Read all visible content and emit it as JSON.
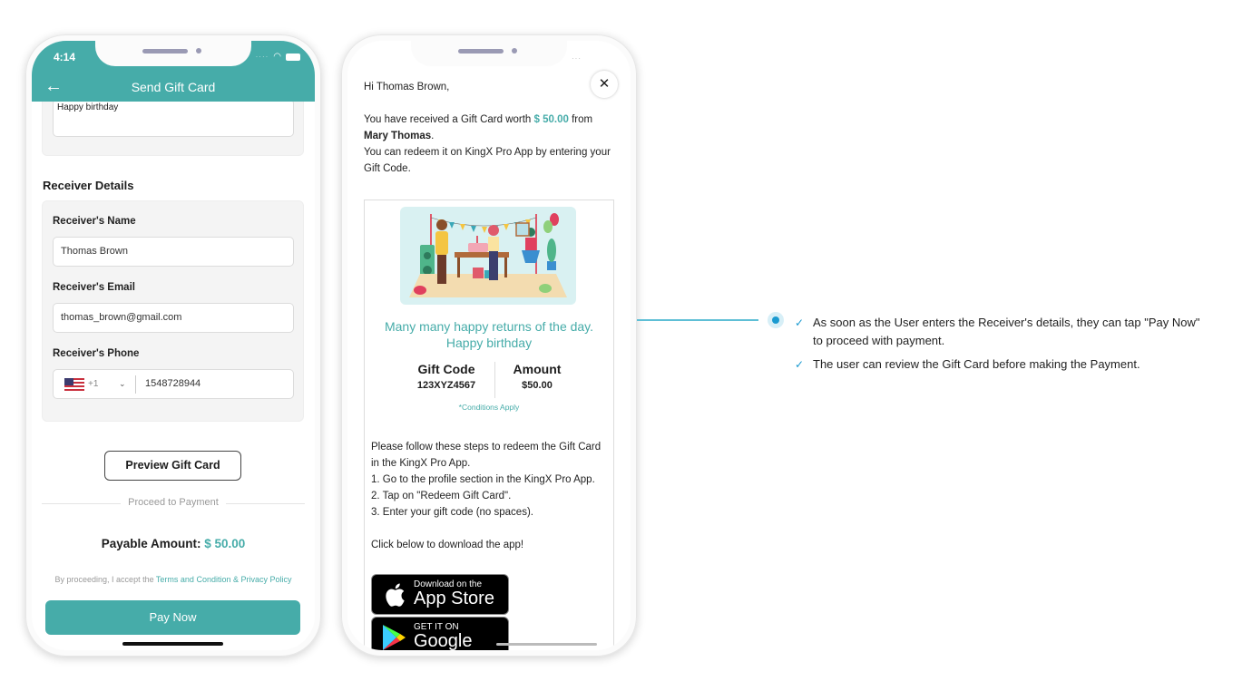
{
  "phone1": {
    "status_time": "4:14",
    "header_title": "Send Gift Card",
    "message_value": "Happy birthday",
    "section_title": "Receiver Details",
    "fields": {
      "name_label": "Receiver's Name",
      "name_value": "Thomas Brown",
      "email_label": "Receiver's Email",
      "email_value": "thomas_brown@gmail.com",
      "phone_label": "Receiver's Phone",
      "country_code": "+1",
      "phone_value": "1548728944"
    },
    "preview_button": "Preview Gift Card",
    "divider_text": "Proceed to Payment",
    "payable_label": "Payable Amount:",
    "payable_amount": "$ 50.00",
    "terms_prefix": "By proceeding, I accept the ",
    "terms_link": "Terms and Condition & Privacy Policy",
    "pay_button": "Pay Now"
  },
  "phone2": {
    "greeting": "Hi Thomas Brown,",
    "intro_prefix": "You have received a Gift Card worth ",
    "intro_amount": "$ 50.00",
    "intro_from": " from",
    "sender": "Mary Thomas",
    "redeem_note": "You can redeem it on KingX Pro App by entering your Gift Code.",
    "wish_line1": "Many many happy returns of the day.",
    "wish_line2": "Happy birthday",
    "gift_code_label": "Gift Code",
    "gift_code_value": "123XYZ4567",
    "amount_label": "Amount",
    "amount_value": "$50.00",
    "conditions": "*Conditions Apply",
    "steps": [
      "Please follow these steps to redeem the Gift Card in the KingX Pro App.",
      "1. Go to the profile section in the KingX Pro App.",
      "2. Tap on \"Redeem Gift Card\".",
      "3. Enter your gift code (no spaces)."
    ],
    "download_prompt": "Click below to download the app!",
    "app_store_small": "Download on the",
    "app_store_big": "App Store",
    "google_play_small": "GET IT ON",
    "google_play_big": "Google Play"
  },
  "annotation": {
    "items": [
      "As soon as the User enters the Receiver's details, they can tap \"Pay Now\" to proceed with payment.",
      "The user can review the Gift Card before making the Payment."
    ]
  },
  "colors": {
    "brand_teal": "#46aca9",
    "annotation_blue": "#1a9ad0"
  }
}
